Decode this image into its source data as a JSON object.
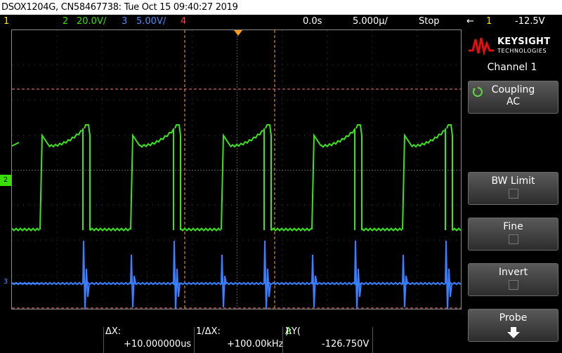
{
  "title_bar": {
    "text": "DSOX1204G, CN58467738: Tue Oct 15 09:40:27 2019"
  },
  "top_bar": {
    "ch1_num": "1",
    "ch2_num": "2",
    "ch2_scale": "20.0V/",
    "ch3_num": "3",
    "ch3_scale": "5.00V/",
    "ch4_num": "4",
    "time_offset": "0.0s",
    "time_scale": "5.000µ/",
    "run_state": "Stop",
    "trigger_icon": "←",
    "trigger_channel": "1",
    "trigger_level": "-12.5V",
    "colors": {
      "ch1": "#f7e600",
      "ch2": "#38e000",
      "ch3": "#4a90ff",
      "ch4": "#ff4040"
    }
  },
  "waveform": {
    "ch2_marker": "2",
    "ch3_marker": "3",
    "icons": [
      "trigger-position-icon",
      "ch2-ground-marker-icon",
      "ch3-ground-marker-icon"
    ]
  },
  "right_panel": {
    "brand": "KEYSIGHT",
    "brand_sub": "TECHNOLOGIES",
    "menu_title": "Channel 1",
    "coupling_label": "Coupling",
    "coupling_value": "AC",
    "bw_limit_label": "BW Limit",
    "fine_label": "Fine",
    "invert_label": "Invert",
    "probe_label": "Probe"
  },
  "measurements": {
    "dx_label": "ΔX:",
    "dx_value": "+10.000000us",
    "inv_dx_label": "1/ΔX:",
    "inv_dx_value": "+100.00kHz",
    "dy_label_prefix": "ΔY(",
    "dy_channel": "2",
    "dy_label_suffix": "):",
    "dy_value": "-126.750V"
  }
}
